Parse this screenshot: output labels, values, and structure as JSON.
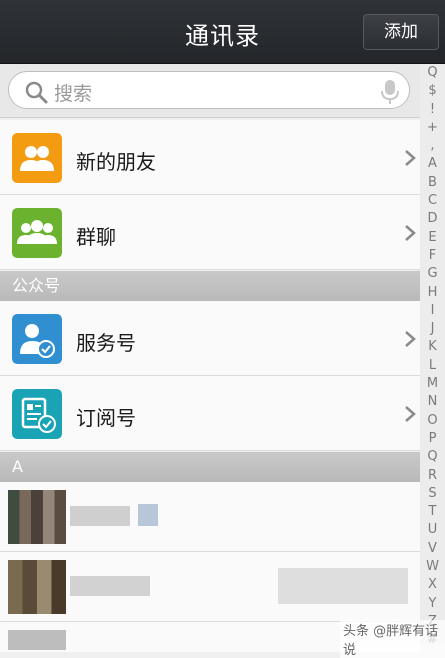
{
  "header": {
    "title": "通讯录",
    "add_label": "添加"
  },
  "search": {
    "placeholder": "搜索"
  },
  "rows": [
    {
      "label": "新的朋友",
      "icon": "new-friends-icon",
      "color": "#f39c12"
    },
    {
      "label": "群聊",
      "icon": "group-chat-icon",
      "color": "#6bb32e"
    },
    {
      "label": "服务号",
      "icon": "service-account-icon",
      "color": "#2f8fd1"
    },
    {
      "label": "订阅号",
      "icon": "subscription-account-icon",
      "color": "#1aa3b5"
    }
  ],
  "sections": {
    "public": "公众号",
    "a": "A"
  },
  "index_letters": [
    "Q",
    "$",
    "!",
    "+",
    ",",
    "A",
    "B",
    "C",
    "D",
    "E",
    "F",
    "G",
    "H",
    "I",
    "J",
    "K",
    "L",
    "M",
    "N",
    "O",
    "P",
    "Q",
    "R",
    "S",
    "T",
    "U",
    "V",
    "W",
    "X",
    "Y",
    "Z",
    "#"
  ],
  "watermark": "头条 @胖辉有话说"
}
